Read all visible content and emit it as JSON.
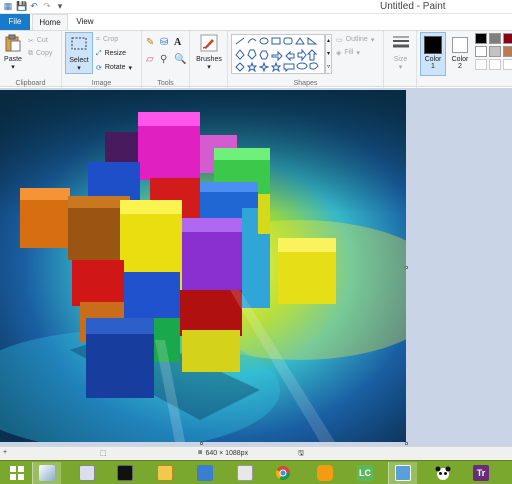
{
  "window": {
    "title": "Untitled - Paint"
  },
  "tabs": {
    "file": "File",
    "home": "Home",
    "view": "View"
  },
  "ribbon": {
    "clipboard": {
      "label": "Clipboard",
      "paste": "Paste",
      "cut": "Cut",
      "copy": "Copy"
    },
    "image": {
      "label": "Image",
      "select": "Select",
      "crop": "Crop",
      "resize": "Resize",
      "rotate": "Rotate"
    },
    "tools": {
      "label": "Tools"
    },
    "brushes": {
      "label": "Brushes"
    },
    "shapes": {
      "label": "Shapes",
      "outline": "Outline",
      "fill": "Fill"
    },
    "size": {
      "label": "Size"
    },
    "color1": {
      "label": "Color",
      "num": "1"
    },
    "color2": {
      "label": "Color",
      "num": "2"
    }
  },
  "palette": [
    "#000000",
    "#7f7f7f",
    "#880015",
    "#ffffff",
    "#c3c3c3",
    "#b97a57",
    "#ffffff",
    "#ffffff",
    "#ffffff"
  ],
  "colors": {
    "primary": "#000000",
    "secondary": "#ffffff",
    "accent": "#1979ca"
  },
  "status": {
    "dimensions": "640 × 1088px"
  }
}
